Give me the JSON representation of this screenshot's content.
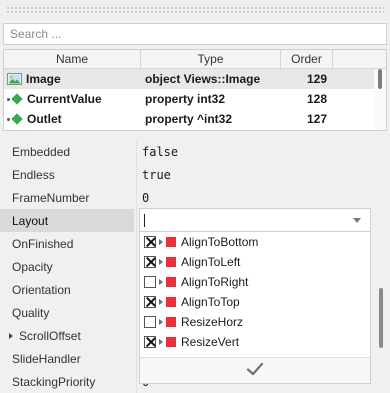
{
  "search": {
    "placeholder": "Search ...",
    "value": ""
  },
  "table": {
    "headers": {
      "name": "Name",
      "type": "Type",
      "order": "Order"
    },
    "rows": [
      {
        "name": "Image",
        "type": "object Views::Image",
        "order": "129",
        "icon": "image-icon"
      },
      {
        "name": "CurrentValue",
        "type": "property int32",
        "order": "128",
        "icon": "property-diamond-icon"
      },
      {
        "name": "Outlet",
        "type": "property ^int32",
        "order": "127",
        "icon": "property-diamond-icon"
      }
    ]
  },
  "properties": [
    {
      "label": "Embedded",
      "value": "false"
    },
    {
      "label": "Endless",
      "value": "true"
    },
    {
      "label": "FrameNumber",
      "value": "0"
    },
    {
      "label": "Layout",
      "value": ""
    },
    {
      "label": "OnFinished",
      "value": ""
    },
    {
      "label": "Opacity",
      "value": ""
    },
    {
      "label": "Orientation",
      "value": ""
    },
    {
      "label": "Quality",
      "value": ""
    },
    {
      "label": "ScrollOffset",
      "value": ""
    },
    {
      "label": "SlideHandler",
      "value": ""
    },
    {
      "label": "StackingPriority",
      "value": "0"
    }
  ],
  "layout_dropdown": {
    "input_value": "",
    "options": [
      {
        "label": "AlignToBottom",
        "checked": true
      },
      {
        "label": "AlignToLeft",
        "checked": true
      },
      {
        "label": "AlignToRight",
        "checked": false
      },
      {
        "label": "AlignToTop",
        "checked": true
      },
      {
        "label": "ResizeHorz",
        "checked": false
      },
      {
        "label": "ResizeVert",
        "checked": true
      }
    ],
    "confirm_icon": "checkmark-icon"
  },
  "colors": {
    "flag": "#e8303a",
    "diamond": "#35a853",
    "selected_row": "#d9d9d9"
  }
}
